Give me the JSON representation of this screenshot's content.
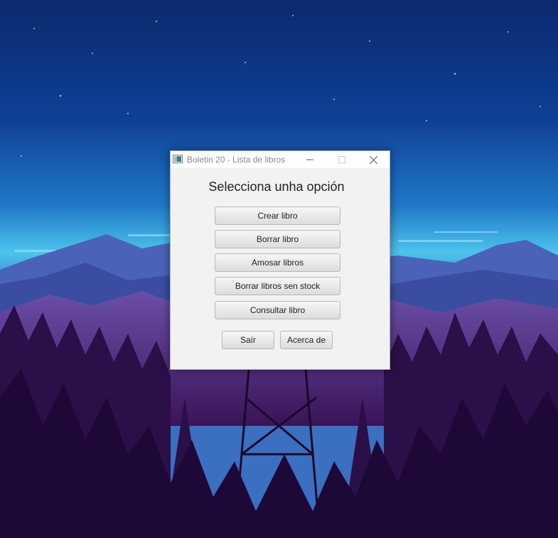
{
  "window": {
    "title": "Boletin 20 - Lista de libros",
    "icon": "java-app-icon"
  },
  "titlebar_controls": {
    "minimize_icon": "minimize-icon",
    "maximize_icon": "maximize-icon",
    "close_icon": "close-icon"
  },
  "main": {
    "heading": "Selecciona unha opción",
    "menu_buttons": [
      {
        "label": "Crear libro"
      },
      {
        "label": "Borrar libro"
      },
      {
        "label": "Amosar libros"
      },
      {
        "label": "Borrar libros sen stock"
      },
      {
        "label": "Consultar libro"
      }
    ]
  },
  "footer": {
    "exit_label": "Saír",
    "about_label": "Acerca de"
  },
  "colors": {
    "window_bg": "#f2f2f2",
    "titlebar_bg": "#ffffff",
    "sky_top": "#0a2a6b",
    "sky_horizon": "#4fc3e8",
    "forest": "#3a1450"
  }
}
